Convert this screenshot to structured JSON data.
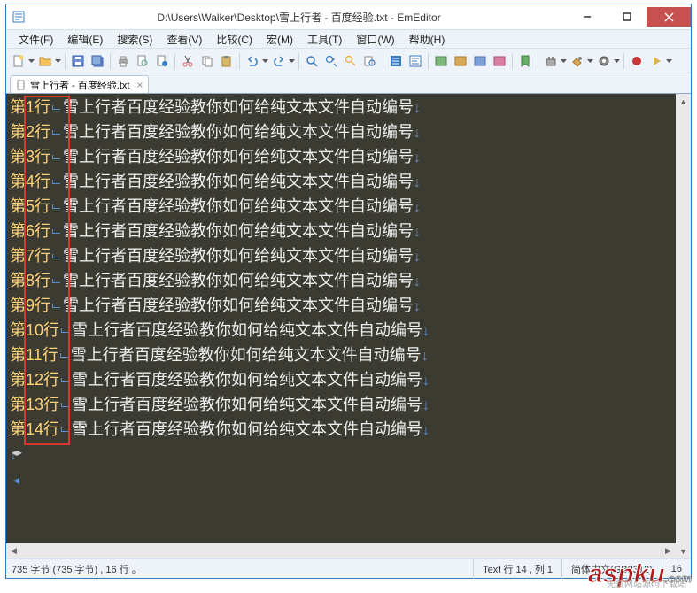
{
  "window": {
    "title": "D:\\Users\\Walker\\Desktop\\雪上行者 - 百度经验.txt - EmEditor"
  },
  "menu": {
    "file": "文件(F)",
    "edit": "编辑(E)",
    "search": "搜索(S)",
    "view": "查看(V)",
    "compare": "比较(C)",
    "macros": "宏(M)",
    "tools": "工具(T)",
    "window": "窗口(W)",
    "help": "帮助(H)"
  },
  "tab": {
    "label": "雪上行者 - 百度经验.txt",
    "close": "×"
  },
  "lines": [
    {
      "prefix": "第1行",
      "body": "雪上行者百度经验教你如何给纯文本文件自动编号"
    },
    {
      "prefix": "第2行",
      "body": "雪上行者百度经验教你如何给纯文本文件自动编号"
    },
    {
      "prefix": "第3行",
      "body": "雪上行者百度经验教你如何给纯文本文件自动编号"
    },
    {
      "prefix": "第4行",
      "body": "雪上行者百度经验教你如何给纯文本文件自动编号"
    },
    {
      "prefix": "第5行",
      "body": "雪上行者百度经验教你如何给纯文本文件自动编号"
    },
    {
      "prefix": "第6行",
      "body": "雪上行者百度经验教你如何给纯文本文件自动编号"
    },
    {
      "prefix": "第7行",
      "body": "雪上行者百度经验教你如何给纯文本文件自动编号"
    },
    {
      "prefix": "第8行",
      "body": "雪上行者百度经验教你如何给纯文本文件自动编号"
    },
    {
      "prefix": "第9行",
      "body": "雪上行者百度经验教你如何给纯文本文件自动编号"
    },
    {
      "prefix": "第10行",
      "body": "雪上行者百度经验教你如何给纯文本文件自动编号"
    },
    {
      "prefix": "第11行",
      "body": "雪上行者百度经验教你如何给纯文本文件自动编号"
    },
    {
      "prefix": "第12行",
      "body": "雪上行者百度经验教你如何给纯文本文件自动编号"
    },
    {
      "prefix": "第13行",
      "body": "雪上行者百度经验教你如何给纯文本文件自动编号"
    },
    {
      "prefix": "第14行",
      "body": "雪上行者百度经验教你如何给纯文本文件自动编号"
    }
  ],
  "newline_glyph": "↓",
  "eof_glyph": "◂",
  "status": {
    "left": "735 字节 (735 字节) , 16 行 。",
    "pos": "Text  行 14 , 列 1",
    "encoding": "简体中文(GB2312)",
    "linecount": "16"
  },
  "watermark": {
    "main": "aspku",
    "suffix": ".com",
    "sub": "免费网站源码下载站"
  }
}
